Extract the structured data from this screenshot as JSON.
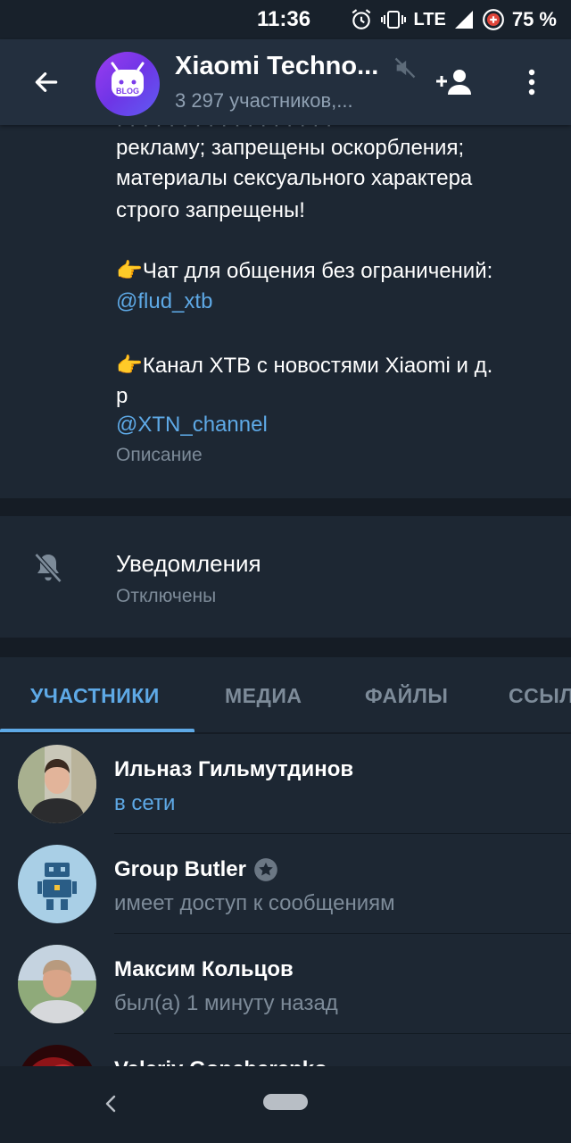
{
  "status_bar": {
    "time": "11:36",
    "network": "LTE",
    "battery": "75 %",
    "icons": [
      "alarm-icon",
      "vibrate-icon",
      "signal-icon",
      "battery-saver-icon"
    ]
  },
  "header": {
    "title": "Xiaomi Techno...",
    "subtitle": "3 297 участников,...",
    "avatar_text": "BLOG",
    "icons": [
      "back-arrow-icon",
      "muted-icon",
      "add-member-icon",
      "more-vert-icon"
    ]
  },
  "description": {
    "lines": [
      "рекламу; запрещены оскорбления;",
      "материалы сексуального характера",
      "строго запрещены!",
      "👉Чат для общения без ограничений:",
      "@flud_xtb",
      "👉Канал XTB с новостями Xiaomi и д.",
      "р",
      "@XTN_channel"
    ],
    "caption": "Описание"
  },
  "notifications": {
    "title": "Уведомления",
    "status": "Отключены"
  },
  "tabs": [
    {
      "label": "УЧАСТНИКИ",
      "active": true
    },
    {
      "label": "МЕДИА",
      "active": false
    },
    {
      "label": "ФАЙЛЫ",
      "active": false
    },
    {
      "label": "ССЫЛ",
      "active": false
    }
  ],
  "members": [
    {
      "name": "Ильназ Гильмутдинов",
      "status": "в сети",
      "online": true
    },
    {
      "name": "Group Butler",
      "status": "имеет доступ к сообщениям",
      "online": false,
      "badge": "star-badge-icon"
    },
    {
      "name": "Максим Кольцов",
      "status": "был(а) 1 минуту назад",
      "online": false
    },
    {
      "name": "Valeriy Goncharenko",
      "status": "",
      "online": false
    }
  ],
  "colors": {
    "background": "#1d2733",
    "header": "#232f3e",
    "accent": "#5ea9e6",
    "secondary_text": "#7d8b99"
  }
}
